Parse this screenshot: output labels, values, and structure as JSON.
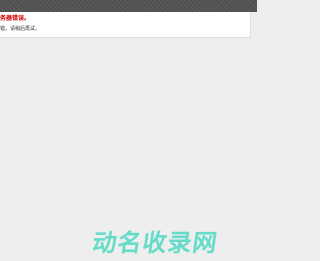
{
  "error": {
    "title": "务器错误。",
    "message": "错，请稍后再试。"
  },
  "watermark": {
    "text": "动名收录网",
    "color": "#4ed9c2"
  },
  "colors": {
    "background": "#eeeeee",
    "top_bar": "#555555",
    "error_title": "#cc0000"
  }
}
